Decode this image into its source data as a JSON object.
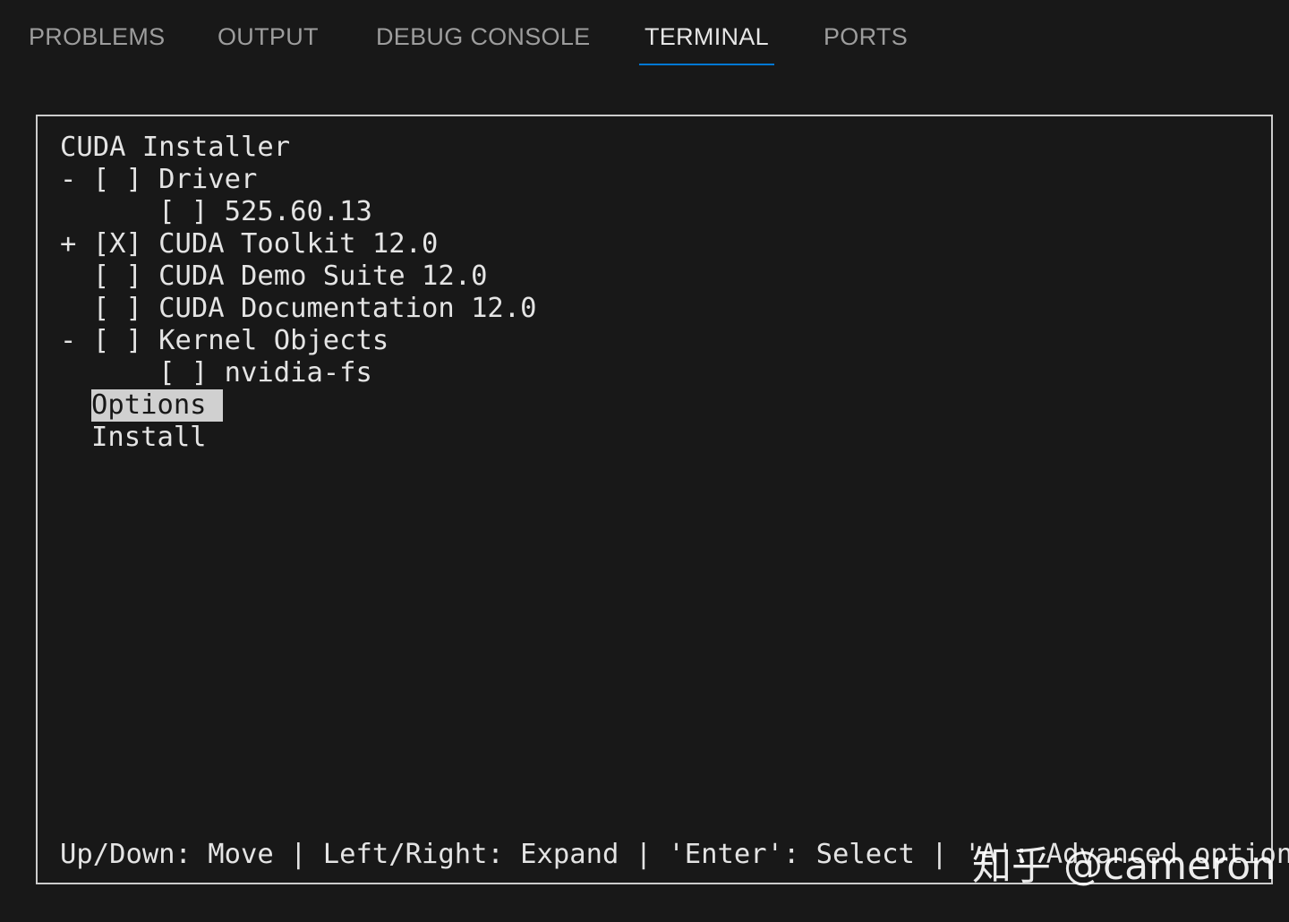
{
  "tabs": [
    {
      "label": "PROBLEMS",
      "active": false
    },
    {
      "label": "OUTPUT",
      "active": false
    },
    {
      "label": "DEBUG CONSOLE",
      "active": false
    },
    {
      "label": "TERMINAL",
      "active": true
    },
    {
      "label": "PORTS",
      "active": false
    }
  ],
  "terminal": {
    "title": "CUDA Installer",
    "tree": [
      {
        "text": "- [ ] Driver"
      },
      {
        "text": "      [ ] 525.60.13"
      },
      {
        "text": "+ [X] CUDA Toolkit 12.0"
      },
      {
        "text": "  [ ] CUDA Demo Suite 12.0"
      },
      {
        "text": "  [ ] CUDA Documentation 12.0"
      },
      {
        "text": "- [ ] Kernel Objects"
      },
      {
        "text": "      [ ] nvidia-fs"
      }
    ],
    "menu": [
      {
        "label": "Options",
        "selected": true
      },
      {
        "label": "Install",
        "selected": false
      }
    ],
    "help": "Up/Down: Move | Left/Right: Expand | 'Enter': Select | 'A': Advanced options"
  },
  "watermark": "知乎 @cameron",
  "colors": {
    "background": "#181818",
    "text": "#e4e4e4",
    "tab_inactive": "#9d9d9d",
    "tab_active": "#e6e6e6",
    "tab_underline": "#0078d4",
    "selection_background": "#d0d0d0"
  }
}
